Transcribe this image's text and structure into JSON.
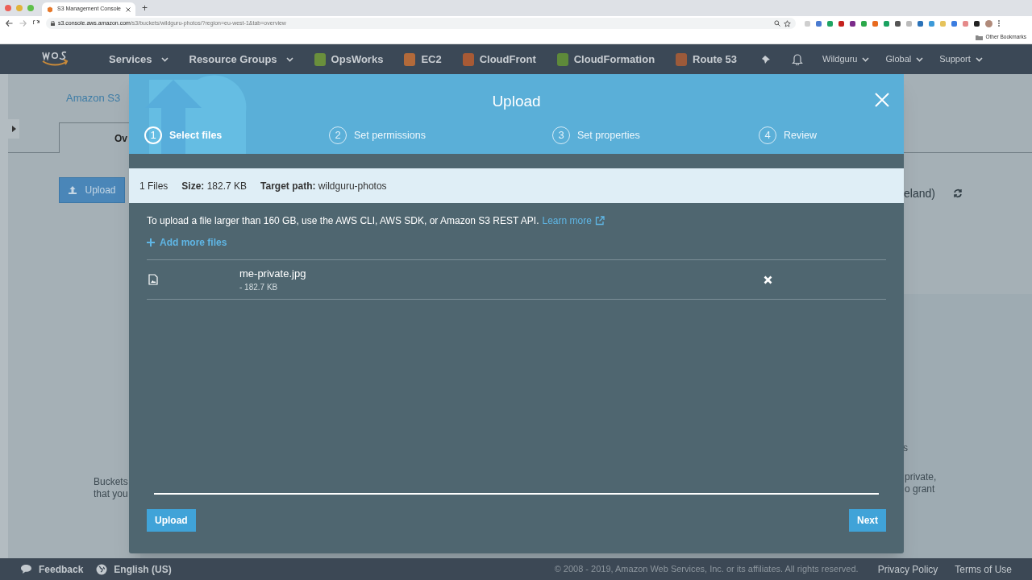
{
  "browser": {
    "tab_title": "S3 Management Console",
    "new_tab": "+",
    "url_host": "s3.console.aws.amazon.com",
    "url_path": "/s3/buckets/wildguru-photos/?region=eu-west-1&tab=overview",
    "bookmarks": [
      "Other Bookmarks"
    ]
  },
  "nav": {
    "items": [
      {
        "label": "Services",
        "kind": "menu"
      },
      {
        "label": "Resource Groups",
        "kind": "menu"
      },
      {
        "label": "OpsWorks",
        "kind": "service",
        "color": "#6a8f3c"
      },
      {
        "label": "EC2",
        "kind": "service",
        "color": "#b36a3a"
      },
      {
        "label": "CloudFront",
        "kind": "service",
        "color": "#a85a35"
      },
      {
        "label": "CloudFormation",
        "kind": "service",
        "color": "#5e8a3a"
      },
      {
        "label": "Route 53",
        "kind": "service",
        "color": "#9c5a3a"
      }
    ],
    "right": [
      "Wildguru",
      "Global",
      "Support"
    ]
  },
  "background_page": {
    "breadcrumb": "Amazon S3",
    "tab": "Ov",
    "upload_button": "Upload",
    "region": "eland)",
    "text_left": [
      "Buckets",
      "that you"
    ],
    "text_right": [
      "s",
      "private,",
      "o grant"
    ]
  },
  "modal": {
    "title": "Upload",
    "steps": [
      {
        "number": "1",
        "label": "Select files",
        "selected": true
      },
      {
        "number": "2",
        "label": "Set permissions",
        "selected": false
      },
      {
        "number": "3",
        "label": "Set properties",
        "selected": false
      },
      {
        "number": "4",
        "label": "Review",
        "selected": false
      }
    ],
    "summary": {
      "count": "1 Files",
      "size_label": "Size:",
      "size": "182.7 KB",
      "target_label": "Target path:",
      "target": "wildguru-photos"
    },
    "notice": "To upload a file larger than 160 GB, use the AWS CLI, AWS SDK, or Amazon S3 REST API.",
    "learn_more": "Learn more",
    "add_more": "Add more files",
    "files": [
      {
        "name": "me-private.jpg",
        "size": "- 182.7 KB"
      }
    ],
    "buttons": {
      "upload": "Upload",
      "next": "Next"
    }
  },
  "footer": {
    "feedback": "Feedback",
    "language": "English (US)",
    "copyright": "© 2008 - 2019, Amazon Web Services, Inc. or its affiliates. All rights reserved.",
    "links": [
      "Privacy Policy",
      "Terms of Use"
    ]
  }
}
